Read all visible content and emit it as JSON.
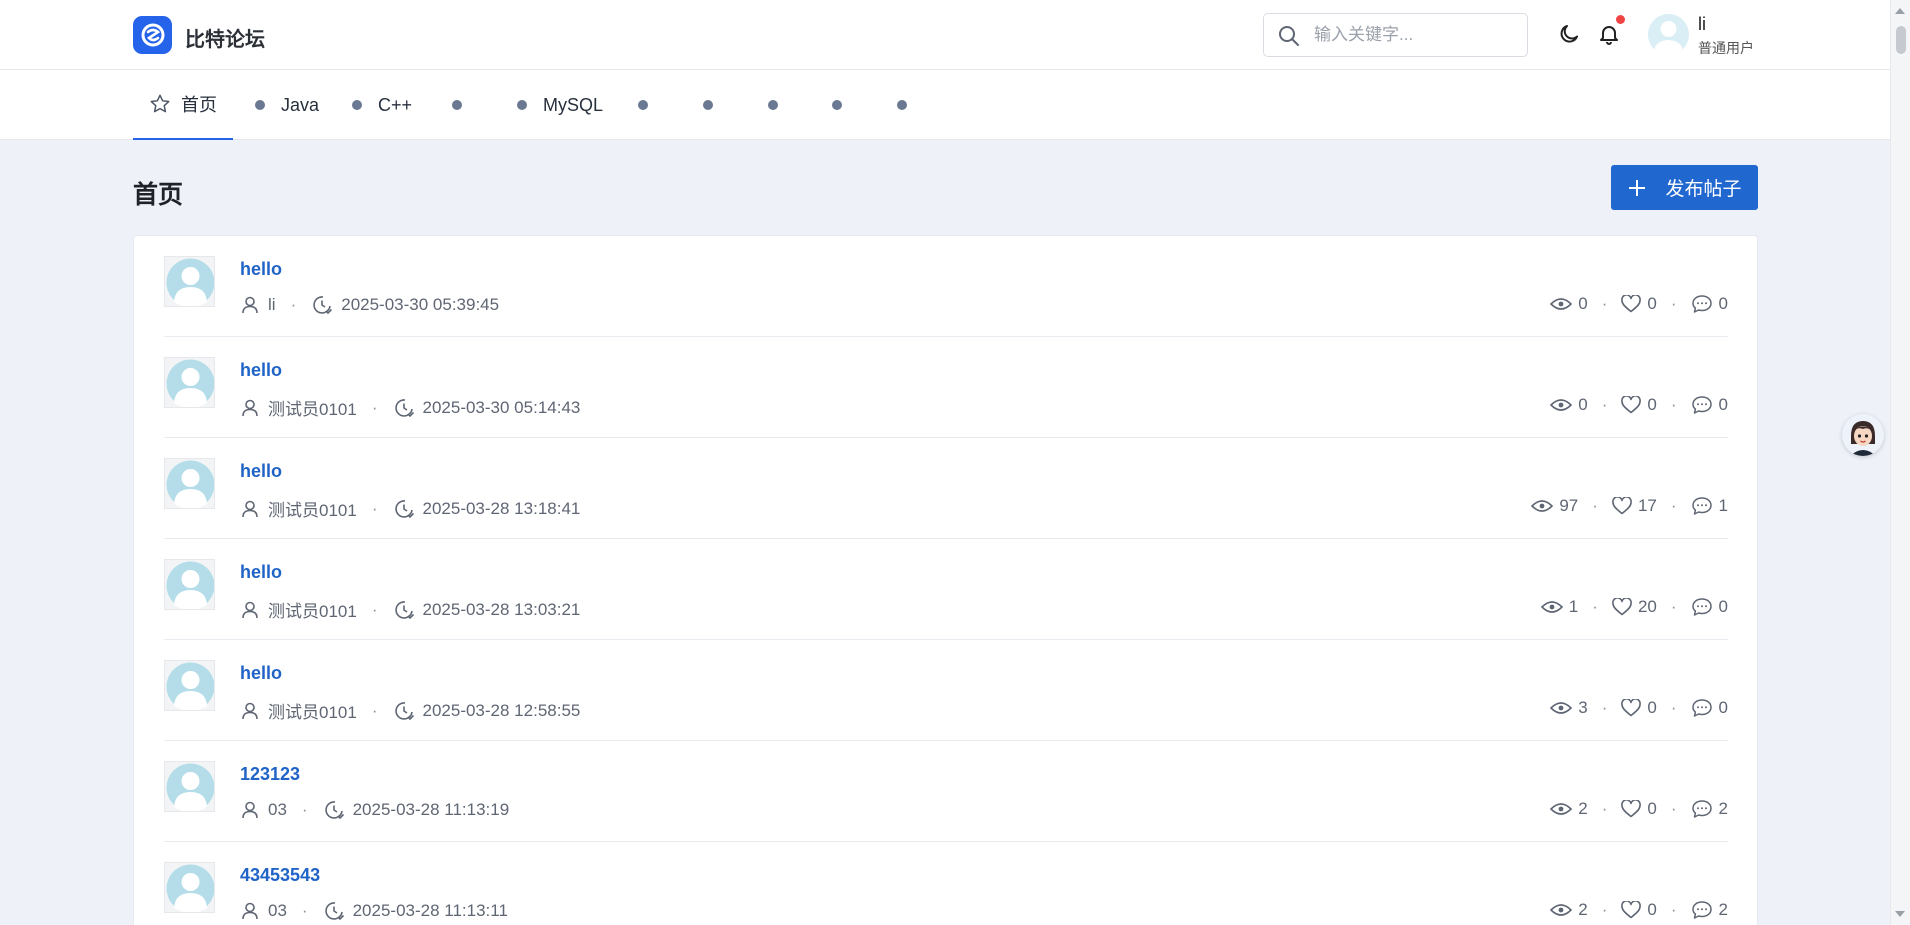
{
  "header": {
    "brand": "比特论坛",
    "search_placeholder": "输入关键字...",
    "user_name": "li",
    "user_role": "普通用户",
    "accent": "#2563eb",
    "notification_dot_color": "#ef4444"
  },
  "tabs": [
    {
      "label": "首页",
      "icon": "star-icon",
      "active": true
    },
    {
      "label": "Java"
    },
    {
      "label": "C++"
    },
    {
      "label": ""
    },
    {
      "label": "MySQL"
    },
    {
      "label": ""
    },
    {
      "label": ""
    },
    {
      "label": ""
    },
    {
      "label": ""
    },
    {
      "label": ""
    }
  ],
  "main": {
    "page_title": "首页",
    "publish_label": "发布帖子"
  },
  "posts": [
    {
      "title": "hello",
      "author": "li",
      "time": "2025-03-30 05:39:45",
      "views": "0",
      "likes": "0",
      "comments": "0"
    },
    {
      "title": "hello",
      "author": "测试员0101",
      "time": "2025-03-30 05:14:43",
      "views": "0",
      "likes": "0",
      "comments": "0"
    },
    {
      "title": "hello",
      "author": "测试员0101",
      "time": "2025-03-28 13:18:41",
      "views": "97",
      "likes": "17",
      "comments": "1"
    },
    {
      "title": "hello",
      "author": "测试员0101",
      "time": "2025-03-28 13:03:21",
      "views": "1",
      "likes": "20",
      "comments": "0"
    },
    {
      "title": "hello",
      "author": "测试员0101",
      "time": "2025-03-28 12:58:55",
      "views": "3",
      "likes": "0",
      "comments": "0"
    },
    {
      "title": "123123",
      "author": "03",
      "time": "2025-03-28 11:13:19",
      "views": "2",
      "likes": "0",
      "comments": "2"
    },
    {
      "title": "43453543",
      "author": "03",
      "time": "2025-03-28 11:13:11",
      "views": "2",
      "likes": "0",
      "comments": "2"
    }
  ]
}
